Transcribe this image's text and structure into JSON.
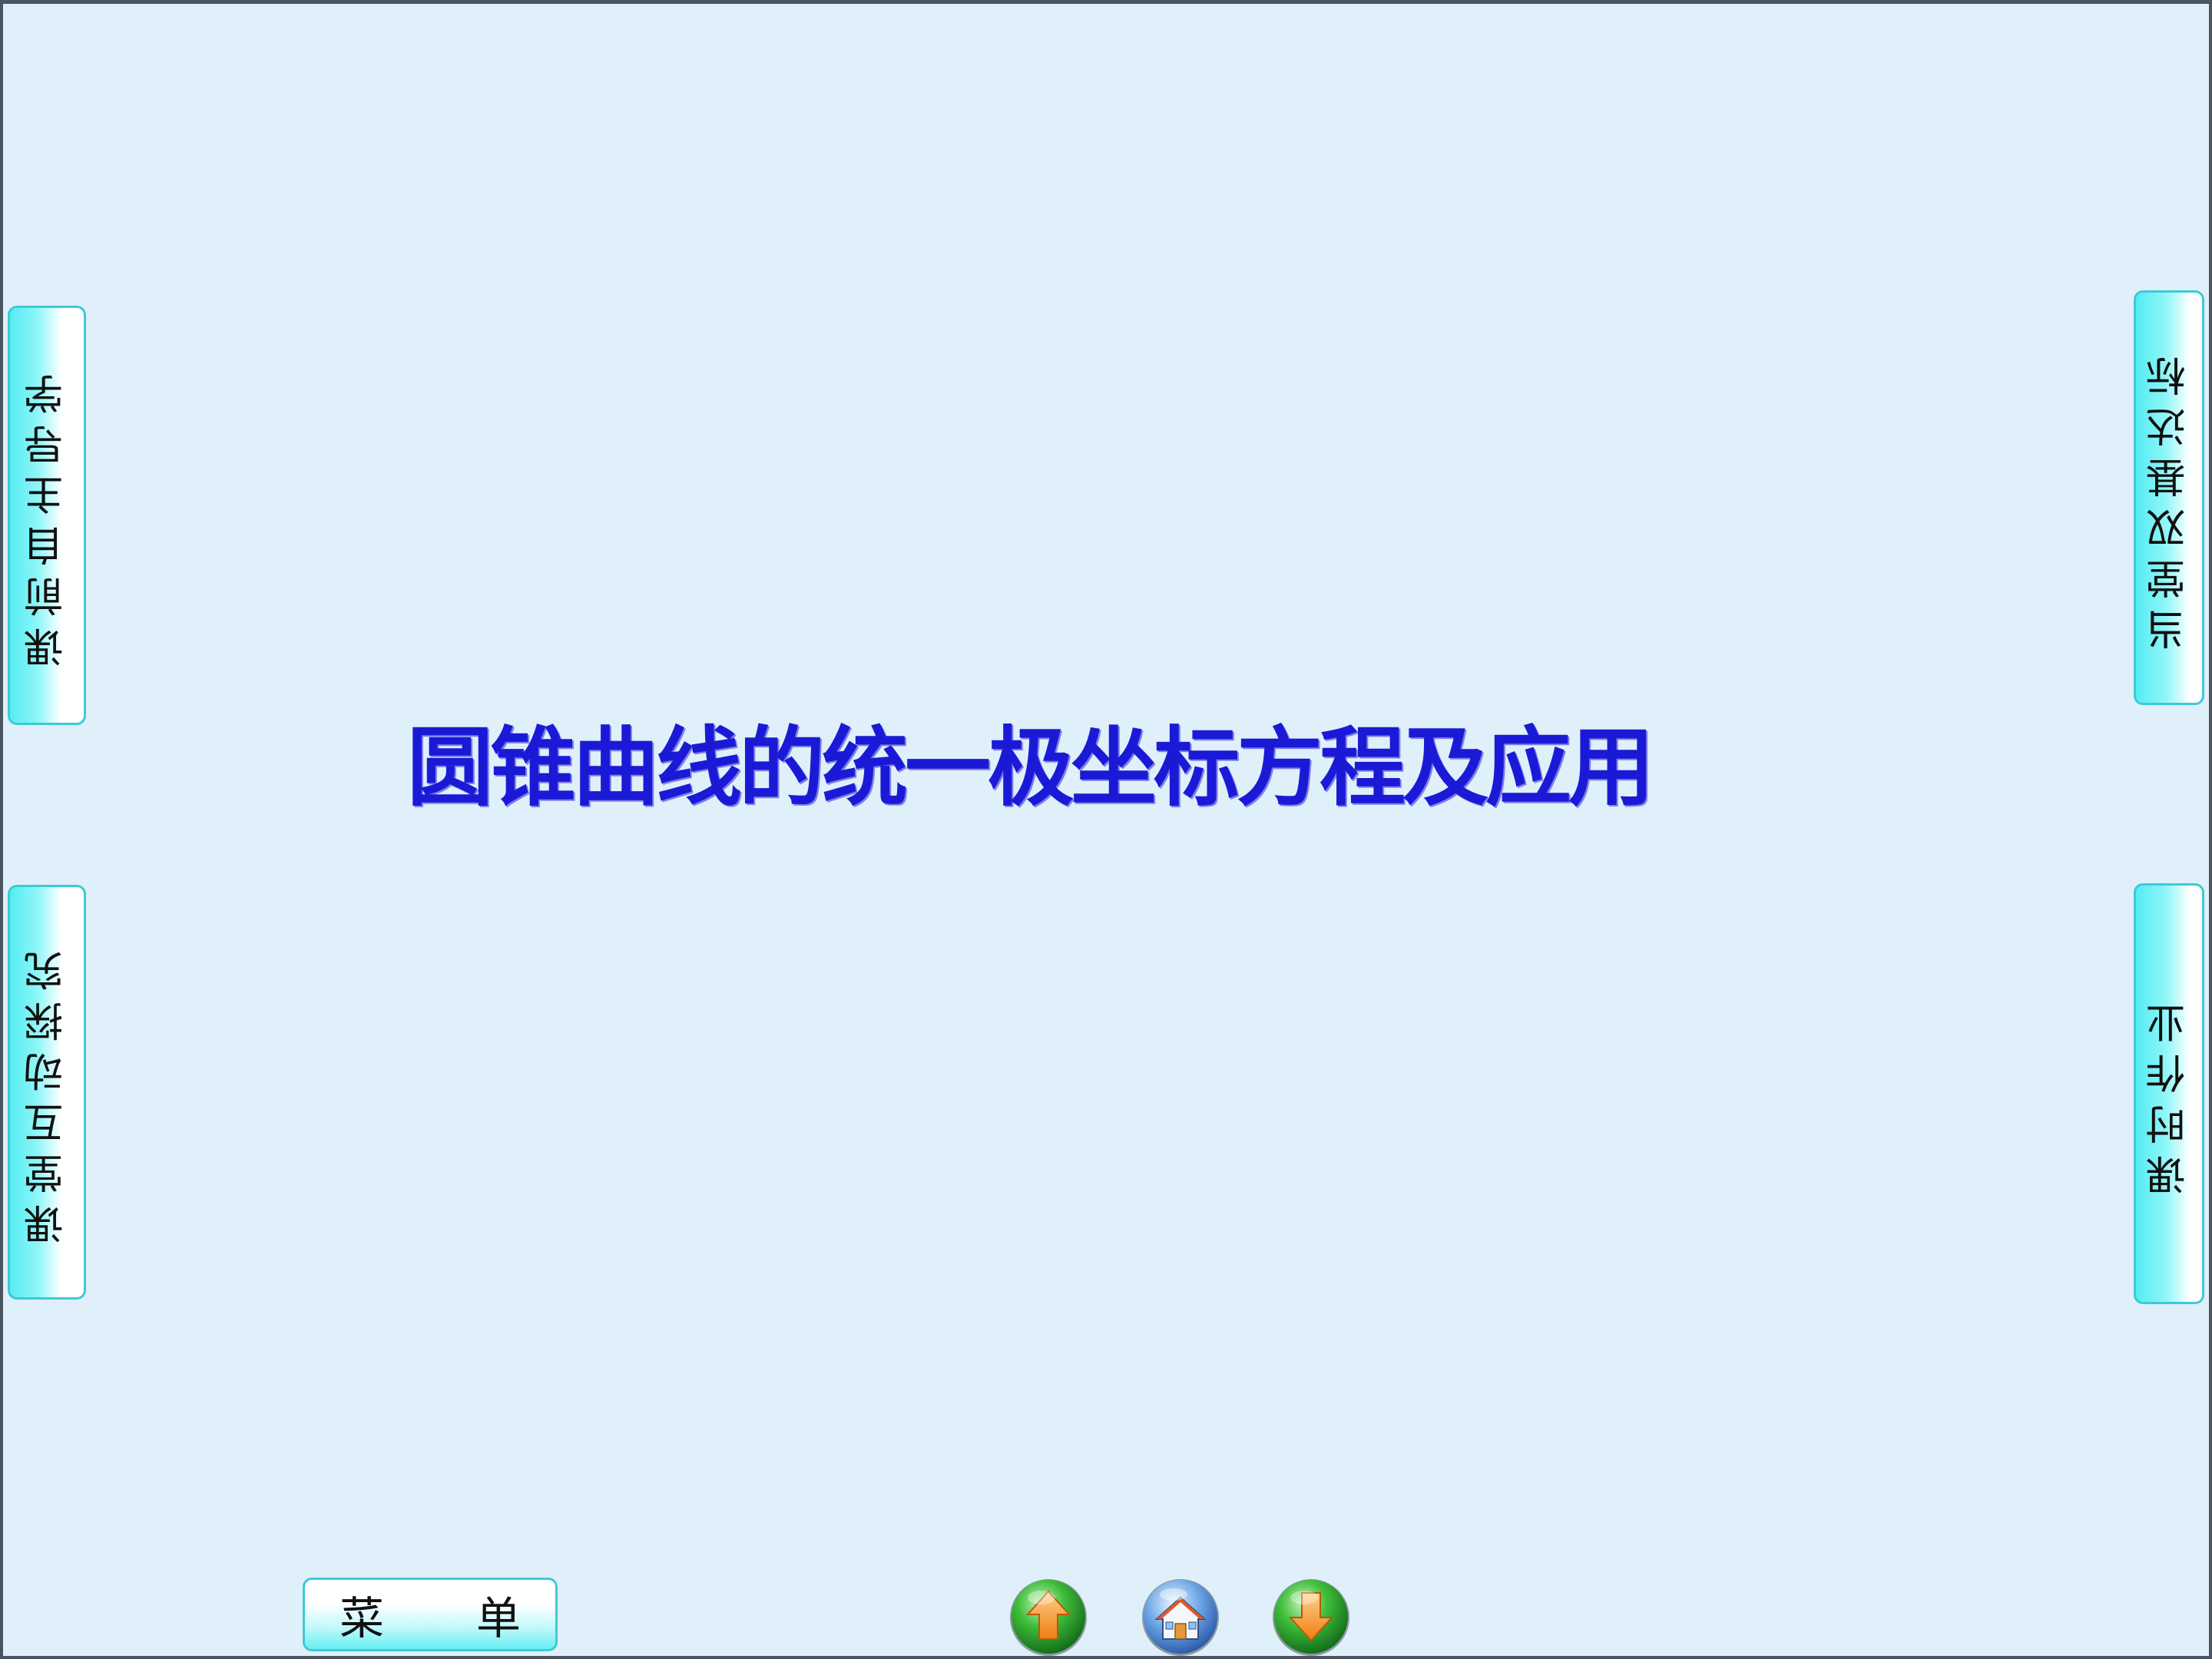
{
  "slide": {
    "title": "圆锥曲线的统一极坐标方程及应用"
  },
  "side_tabs": {
    "left_top": "课前自主导学",
    "left_bottom": "课堂互动探究",
    "right_top": "当堂双基达标",
    "right_bottom": "课时作业"
  },
  "menu": {
    "label": "菜单"
  },
  "nav": {
    "prev_icon": "up-arrow-icon",
    "home_icon": "home-icon",
    "next_icon": "down-arrow-icon"
  },
  "colors": {
    "background": "#dff0fa",
    "title": "#1a1ad6",
    "tab_accent": "#55ecf2",
    "tab_border": "#3fc9d6",
    "nav_green": "#1f9a2a",
    "nav_orange": "#f28a1c",
    "home_blue": "#3a7bd5"
  }
}
